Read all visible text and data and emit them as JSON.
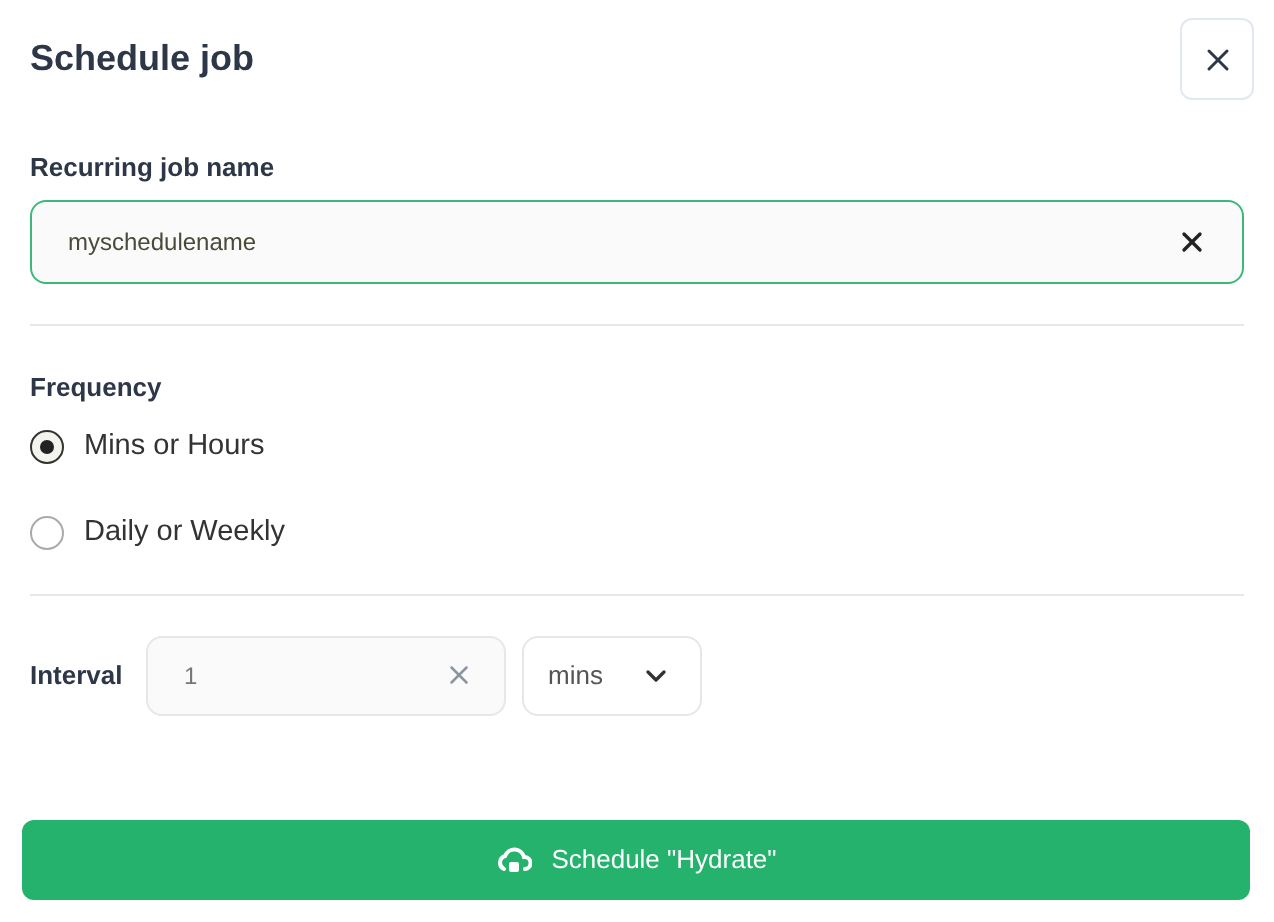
{
  "dialog": {
    "title": "Schedule job"
  },
  "name_field": {
    "label": "Recurring job name",
    "value": "myschedulename"
  },
  "frequency": {
    "label": "Frequency",
    "options": [
      {
        "label": "Mins or Hours",
        "selected": true
      },
      {
        "label": "Daily or Weekly",
        "selected": false
      }
    ]
  },
  "interval": {
    "label": "Interval",
    "value": "1",
    "unit": "mins"
  },
  "submit": {
    "label": "Schedule \"Hydrate\""
  }
}
